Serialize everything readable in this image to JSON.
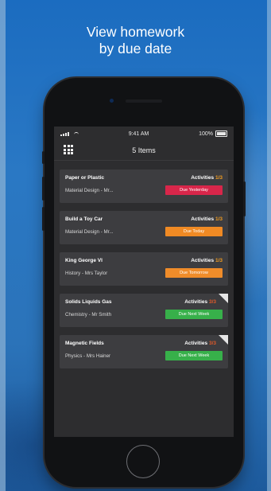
{
  "promo": {
    "line1": "View homework",
    "line2": "by due date"
  },
  "status_bar": {
    "time": "9:41 AM",
    "battery": "100%"
  },
  "header": {
    "title": "5 Items"
  },
  "colors": {
    "overdue": "#d8264a",
    "today": "#f08a24",
    "tomorrow": "#ef8c2a",
    "next_week": "#37b04a",
    "activity_count": "#f29c1f"
  },
  "items": [
    {
      "title": "Paper or Plastic",
      "activities_label": "Activities",
      "activities_count": "1/3",
      "subtitle": "Material Design - Mr...",
      "due": "Due Yesterday",
      "due_color": "#d8264a",
      "completed_corner": false
    },
    {
      "title": "Build a Toy Car",
      "activities_label": "Activities",
      "activities_count": "1/3",
      "subtitle": "Material Design - Mr...",
      "due": "Due Today",
      "due_color": "#f08a24",
      "completed_corner": false
    },
    {
      "title": "King George VI",
      "activities_label": "Activities",
      "activities_count": "1/3",
      "subtitle": "History - Mrs Taylor",
      "due": "Due Tomorrow",
      "due_color": "#ef8c2a",
      "completed_corner": false
    },
    {
      "title": "Solids Liquids Gas",
      "activities_label": "Activities",
      "activities_count": "3/3",
      "subtitle": "Chemistry - Mr Smith",
      "due": "Due Next Week",
      "due_color": "#37b04a",
      "completed_corner": true
    },
    {
      "title": "Magnetic Fields",
      "activities_label": "Activities",
      "activities_count": "3/3",
      "subtitle": "Physics - Mrs Hainer",
      "due": "Due Next Week",
      "due_color": "#37b04a",
      "completed_corner": true
    }
  ]
}
